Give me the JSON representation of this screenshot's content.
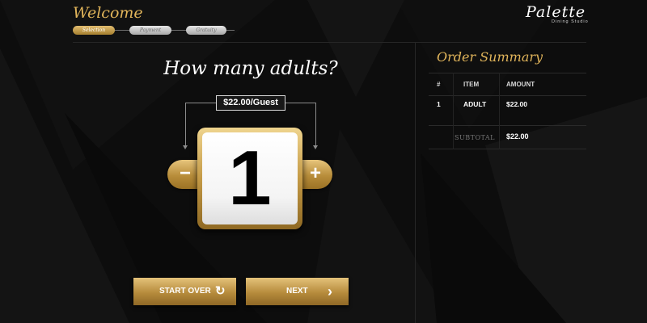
{
  "header": {
    "welcome": "Welcome",
    "steps": [
      {
        "label": "Selection",
        "active": true
      },
      {
        "label": "Payment",
        "active": false
      },
      {
        "label": "Gratuity",
        "active": false
      }
    ],
    "logo": {
      "name": "Palette",
      "subtitle": "Dining Studio"
    }
  },
  "selector": {
    "question": "How many adults?",
    "price": "$22.00/Guest",
    "count": "1",
    "minus": "−",
    "plus": "+"
  },
  "actions": {
    "start_over": "START OVER",
    "next": "NEXT"
  },
  "summary": {
    "title": "Order Summary",
    "columns": [
      "#",
      "ITEM",
      "AMOUNT"
    ],
    "rows": [
      {
        "num": "1",
        "item": "ADULT",
        "amount": "$22.00"
      }
    ],
    "subtotal_label": "SUBTOTAL",
    "subtotal_value": "$22.00"
  },
  "colors": {
    "accent_gold": "#e0b45a",
    "background": "#0c0c0c",
    "button_gold": "#b68b3c"
  },
  "icons": {
    "start_over": "restart-arrow-icon",
    "next": "chevron-right-icon"
  }
}
